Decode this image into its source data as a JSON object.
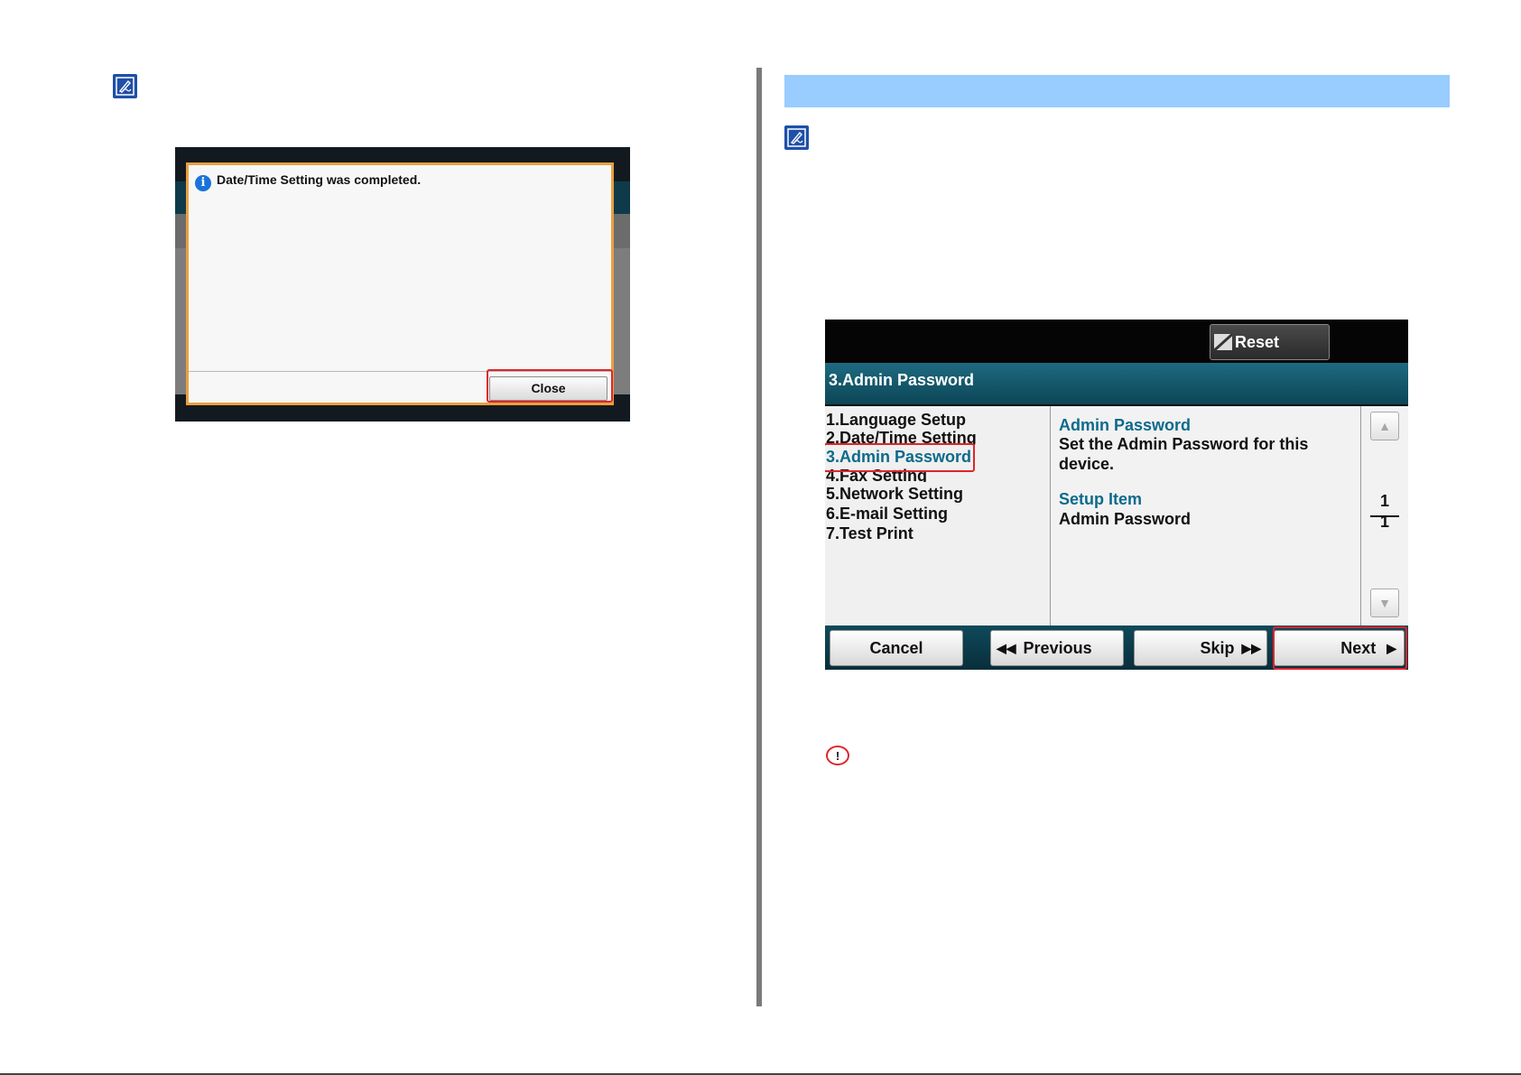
{
  "left_screen": {
    "dialog_message": "Date/Time Setting was completed.",
    "close_button": "Close"
  },
  "right_screen": {
    "reset_button": "Reset",
    "title": "3.Admin Password",
    "menu_items": [
      "1.Language Setup",
      "2.Date/Time Setting",
      "3.Admin Password",
      "4.Fax Setting",
      "5.Network Setting",
      "6.E-mail Setting",
      "7.Test Print"
    ],
    "selected_menu_item": "3.Admin Password",
    "detail": {
      "heading": "Admin Password",
      "description": "Set the Admin Password for this device.",
      "setup_heading": "Setup Item",
      "setup_value": "Admin Password"
    },
    "page_current": "1",
    "page_total": "1",
    "buttons": {
      "cancel": "Cancel",
      "previous": "Previous",
      "skip": "Skip",
      "next": "Next"
    }
  },
  "icons": {
    "note": "pencil-note-icon",
    "info": "info-icon",
    "important": "exclamation-icon",
    "reset": "reset-icon",
    "scroll_up": "scroll-up-arrow-icon",
    "scroll_down": "scroll-down-arrow-icon"
  },
  "colors": {
    "heading_bar": "#99ccff",
    "highlight": "#e0242b",
    "accent_text": "#0c6a8c"
  }
}
